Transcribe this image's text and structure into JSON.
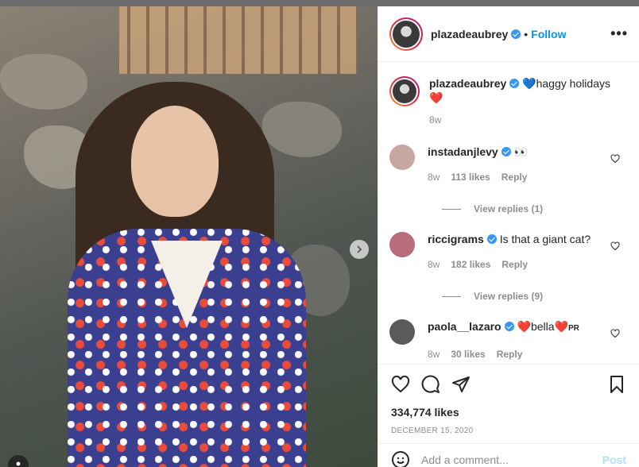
{
  "post": {
    "author": "plazadeaubrey",
    "follow_label": "Follow",
    "more_label": "•••",
    "caption_text": "haggy holidays",
    "caption_age": "8w",
    "likes": "334,774 likes",
    "date": "DECEMBER 15, 2020",
    "add_comment_placeholder": "Add a comment...",
    "post_label": "Post"
  },
  "comments": [
    {
      "user": "instadanjlevy",
      "text": "👀",
      "age": "8w",
      "likes": "113 likes",
      "reply": "Reply",
      "replies": "View replies (1)",
      "avatar_color": "#c7a5a0"
    },
    {
      "user": "riccigrams",
      "text": "Is that a giant cat?",
      "age": "8w",
      "likes": "182 likes",
      "reply": "Reply",
      "replies": "View replies (9)",
      "avatar_color": "#b86b7a"
    },
    {
      "user": "paola__lazaro",
      "text": "bella",
      "suffix": "PR",
      "age": "8w",
      "likes": "30 likes",
      "reply": "Reply",
      "avatar_color": "#5a5a5a"
    }
  ],
  "colors": {
    "accent": "#0095f6",
    "verified": "#3897f0"
  }
}
